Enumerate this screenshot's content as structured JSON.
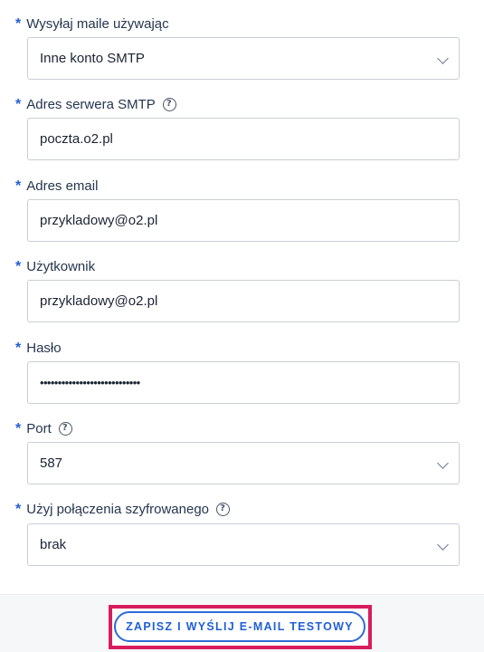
{
  "fields": {
    "send_via": {
      "label": "Wysyłaj maile używając",
      "value": "Inne konto SMTP"
    },
    "smtp_server": {
      "label": "Adres serwera SMTP",
      "value": "poczta.o2.pl"
    },
    "email": {
      "label": "Adres email",
      "value": "przykladowy@o2.pl"
    },
    "username": {
      "label": "Użytkownik",
      "value": "przykladowy@o2.pl"
    },
    "password": {
      "label": "Hasło",
      "value": "••••••••••••••••••••••••••••"
    },
    "port": {
      "label": "Port",
      "value": "587"
    },
    "encryption": {
      "label": "Użyj połączenia szyfrowanego",
      "value": "brak"
    }
  },
  "required_mark": "*",
  "footer": {
    "save_test_label": "ZAPISZ I WYŚLIJ E-MAIL TESTOWY"
  },
  "colors": {
    "accent": "#1f5fd6",
    "highlight": "#d91c5c",
    "border": "#c9ced6"
  }
}
